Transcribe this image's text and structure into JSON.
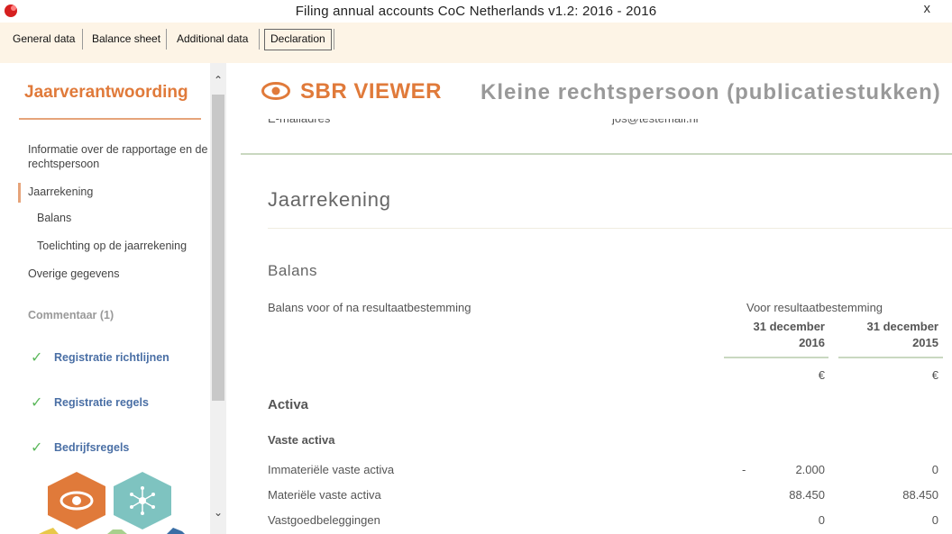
{
  "window": {
    "title": "Filing annual accounts CoC Netherlands v1.2: 2016 - 2016",
    "close_glyph": "x"
  },
  "tabs": [
    {
      "label": "General data"
    },
    {
      "label": "Balance sheet"
    },
    {
      "label": "Additional data"
    },
    {
      "label": "Declaration"
    }
  ],
  "sidebar": {
    "heading": "Jaarverantwoording",
    "items": [
      {
        "label": "Informatie over de rapportage en de rechtspersoon"
      },
      {
        "label": "Jaarrekening"
      },
      {
        "label": "Balans"
      },
      {
        "label": "Toelichting op de jaarrekening"
      },
      {
        "label": "Overige gegevens"
      }
    ],
    "comment": "Commentaar (1)",
    "validators": [
      {
        "label": "Registratie richtlijnen"
      },
      {
        "label": "Registratie regels"
      },
      {
        "label": "Bedrijfsregels"
      }
    ],
    "check_glyph": "✓"
  },
  "scroll": {
    "up_glyph": "⌃",
    "down_glyph": "⌄"
  },
  "header": {
    "brand": "SBR VIEWER",
    "doc_title": "Kleine rechtspersoon (publicatiestukken)"
  },
  "peek": {
    "label": "E-mailadres",
    "value": "jos@testemail.nl"
  },
  "content": {
    "section_title": "Jaarrekening",
    "subsection_title": "Balans",
    "question": "Balans voor of na resultaatbestemming",
    "answer": "Voor resultaatbestemming",
    "columns": [
      {
        "date": "31 december",
        "year": "2016",
        "currency": "€"
      },
      {
        "date": "31 december",
        "year": "2015",
        "currency": "€"
      }
    ],
    "activa": "Activa",
    "vaste_activa": "Vaste activa",
    "rows": [
      {
        "label": "Immateriële vaste activa",
        "prefix": "-",
        "v2016": "2.000",
        "v2015": "0"
      },
      {
        "label": "Materiële vaste activa",
        "prefix": "",
        "v2016": "88.450",
        "v2015": "88.450"
      },
      {
        "label": "Vastgoedbeleggingen",
        "prefix": "",
        "v2016": "0",
        "v2015": "0"
      }
    ]
  },
  "colors": {
    "accent": "#e07a3a",
    "validator": "#4a6fa5",
    "check": "#5cb85c"
  }
}
